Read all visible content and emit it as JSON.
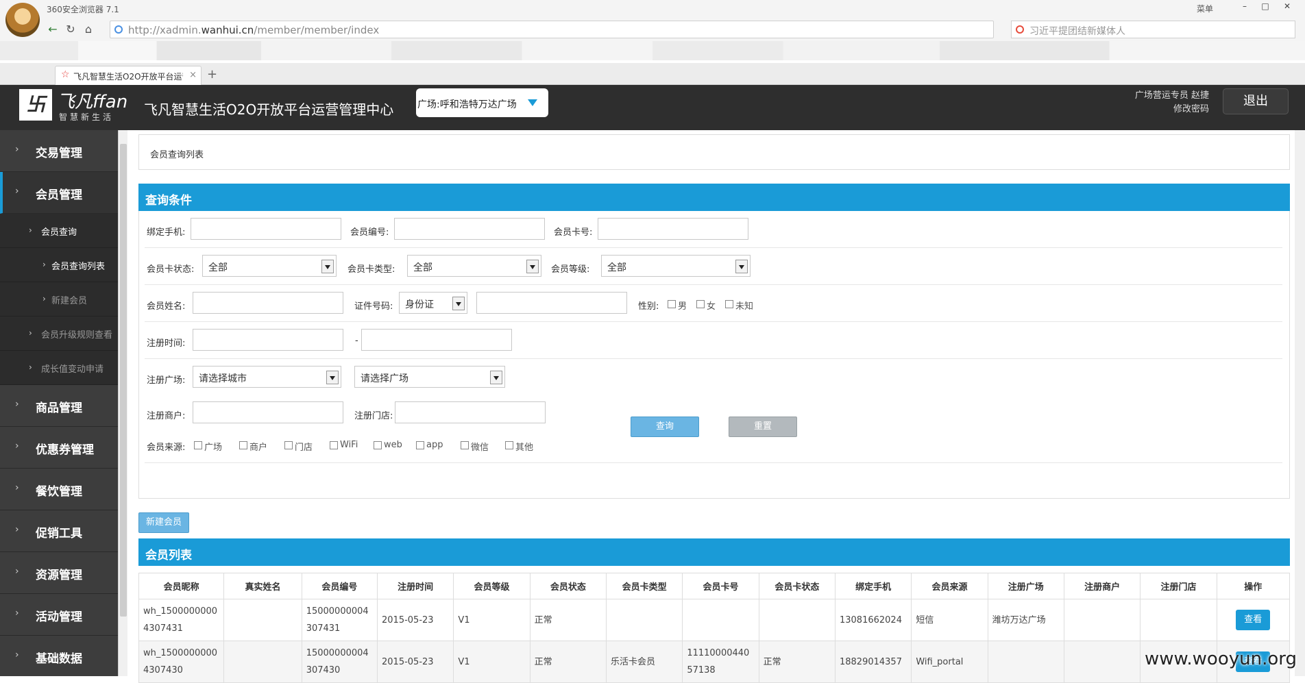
{
  "browser": {
    "window_title": "360安全浏览器 7.1",
    "menu_label": "菜单",
    "url_prefix": "http://xadmin.",
    "url_domain": "wanhui.cn",
    "url_path": "/member/member/index",
    "search_placeholder": "习近平提团结新媒体人",
    "tab_title": "飞凡智慧生活O2O开放平台运营",
    "tab_close": "×",
    "tab_new": "+"
  },
  "header": {
    "logo_brand": "飞凡ffan",
    "logo_slogan": "智慧新生活",
    "app_title": "飞凡智慧生活O2O开放平台运营管理中心",
    "plaza_select": "广场:呼和浩特万达广场",
    "user_role": "广场营运专员 赵捷",
    "change_password": "修改密码",
    "logout": "退出"
  },
  "sidebar": {
    "items": [
      {
        "label": "交易管理"
      },
      {
        "label": "会员管理"
      },
      {
        "label": "商品管理"
      },
      {
        "label": "优惠券管理"
      },
      {
        "label": "餐饮管理"
      },
      {
        "label": "促销工具"
      },
      {
        "label": "资源管理"
      },
      {
        "label": "活动管理"
      },
      {
        "label": "基础数据"
      }
    ],
    "sub": {
      "member_query": "会员查询",
      "member_query_list": "会员查询列表",
      "new_member": "新建会员",
      "upgrade_rules": "会员升级规则查看",
      "growth_change": "成长值变动申请"
    }
  },
  "breadcrumb": "会员查询列表",
  "query": {
    "title": "查询条件",
    "bind_phone": "绑定手机:",
    "member_no": "会员编号:",
    "card_no": "会员卡号:",
    "card_status": "会员卡状态:",
    "card_status_value": "全部",
    "card_type": "会员卡类型:",
    "card_type_value": "全部",
    "member_level": "会员等级:",
    "member_level_value": "全部",
    "member_name": "会员姓名:",
    "id_no": "证件号码:",
    "id_type_value": "身份证",
    "gender": "性别:",
    "gender_male": "男",
    "gender_female": "女",
    "gender_unknown": "未知",
    "reg_time": "注册时间:",
    "reg_time_sep": "-",
    "reg_plaza": "注册广场:",
    "city_placeholder": "请选择城市",
    "plaza_placeholder": "请选择广场",
    "reg_merchant": "注册商户:",
    "reg_store": "注册门店:",
    "source": "会员来源:",
    "sources": [
      "广场",
      "商户",
      "门店",
      "WiFi",
      "web",
      "app",
      "微信",
      "其他"
    ],
    "btn_query": "查询",
    "btn_reset": "重置"
  },
  "new_member_button": "新建会员",
  "list": {
    "title": "会员列表",
    "columns": [
      "会员昵称",
      "真实姓名",
      "会员编号",
      "注册时间",
      "会员等级",
      "会员状态",
      "会员卡类型",
      "会员卡号",
      "会员卡状态",
      "绑定手机",
      "会员来源",
      "注册广场",
      "注册商户",
      "注册门店",
      "操作"
    ],
    "rows": [
      {
        "nickname": "wh_15000000004307431",
        "real_name": "",
        "member_no": "15000000004307431",
        "reg_time": "2015-05-23",
        "level": "V1",
        "status": "正常",
        "card_type": "",
        "card_no": "",
        "card_status": "",
        "phone": "13081662024",
        "source": "短信",
        "plaza": "潍坊万达广场",
        "merchant": "",
        "store": "",
        "action": "查看"
      },
      {
        "nickname": "wh_15000000004307430",
        "real_name": "",
        "member_no": "15000000004307430",
        "reg_time": "2015-05-23",
        "level": "V1",
        "status": "正常",
        "card_type": "乐活卡会员",
        "card_no": "1111000044057138",
        "card_status": "正常",
        "phone": "18829014357",
        "source": "Wifi_portal",
        "plaza": "",
        "merchant": "",
        "store": "",
        "action": "查看"
      }
    ]
  },
  "watermark": "www.wooyun.org"
}
